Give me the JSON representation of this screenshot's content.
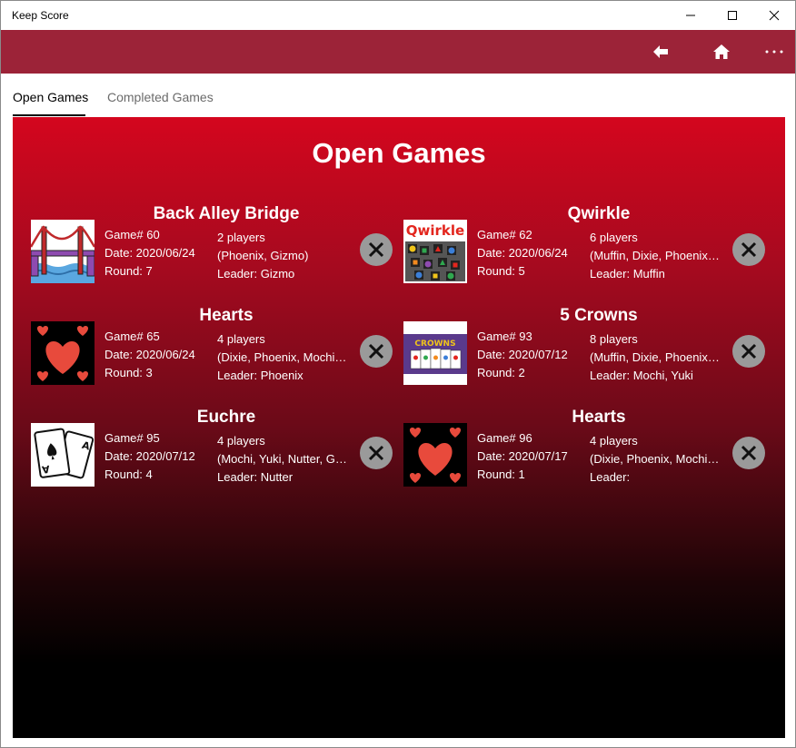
{
  "window": {
    "title": "Keep Score"
  },
  "cmdbar": {
    "back_icon": "back-arrow-icon",
    "home_icon": "home-icon",
    "more_icon": "more-icon"
  },
  "tabs": [
    {
      "label": "Open Games",
      "active": true
    },
    {
      "label": "Completed Games",
      "active": false
    }
  ],
  "main": {
    "title": "Open Games",
    "games": [
      {
        "name": "Back Alley Bridge",
        "image": "bridge",
        "game_no": "Game# 60",
        "date": "Date: 2020/06/24",
        "round": "Round: 7",
        "players": "2 players",
        "player_list": "(Phoenix, Gizmo)",
        "leader": "Leader: Gizmo"
      },
      {
        "name": "Qwirkle",
        "image": "qwirkle",
        "game_no": "Game# 62",
        "date": "Date: 2020/06/24",
        "round": "Round: 5",
        "players": "6 players",
        "player_list": "(Muffin, Dixie, Phoenix, Mochi, Yuki, Gizmo)",
        "leader": "Leader: Muffin"
      },
      {
        "name": "Hearts",
        "image": "hearts",
        "game_no": "Game# 65",
        "date": "Date: 2020/06/24",
        "round": "Round: 3",
        "players": "4 players",
        "player_list": "(Dixie, Phoenix, Mochi, Yuki)",
        "leader": "Leader: Phoenix"
      },
      {
        "name": "5 Crowns",
        "image": "crowns",
        "game_no": "Game# 93",
        "date": "Date: 2020/07/12",
        "round": "Round: 2",
        "players": "8 players",
        "player_list": "(Muffin, Dixie, Phoenix, Mochi, Yuki, Gizmo, Nutter, Bear)",
        "leader": "Leader: Mochi, Yuki"
      },
      {
        "name": "Euchre",
        "image": "cards",
        "game_no": "Game# 95",
        "date": "Date: 2020/07/12",
        "round": "Round: 4",
        "players": "4 players",
        "player_list": "(Mochi, Yuki, Nutter, Gizmo)",
        "leader": "Leader: Nutter"
      },
      {
        "name": "Hearts",
        "image": "hearts",
        "game_no": "Game# 96",
        "date": "Date: 2020/07/17",
        "round": "Round: 1",
        "players": "4 players",
        "player_list": "(Dixie, Phoenix, Mochi, Yuki)",
        "leader": "Leader:"
      }
    ]
  },
  "colors": {
    "cmdbar": "#9c2338",
    "panel_top": "#d4061e",
    "panel_bottom": "#000000",
    "close_button": "#9a9a9a"
  }
}
